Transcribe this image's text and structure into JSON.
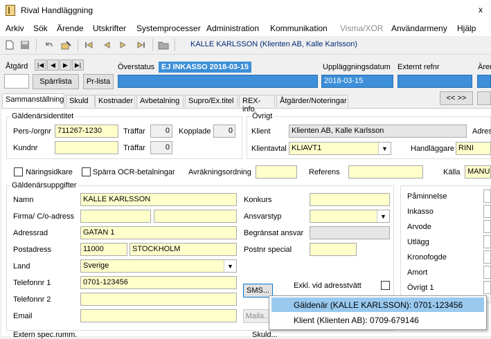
{
  "window": {
    "title": "Rival Handläggning",
    "close_glyph": "x"
  },
  "menu": [
    "Arkiv",
    "Sök",
    "Ärende",
    "Utskrifter",
    "Systemprocesser",
    "Administration",
    "Kommunikation",
    "Visma/XOR",
    "Användarmeny",
    "Hjälp"
  ],
  "toolbar": {
    "client_text": "KALLE KARLSSON (Klienten AB, Kalle Karlsson)"
  },
  "action_bar": {
    "atgard_label": "Åtgärd",
    "sparrlista_button": "Spärrlista",
    "prlista_button": "Pr-lista",
    "overstatus_label": "Överstatus",
    "overstatus_value": "EJ INKASSO 2018-03-15",
    "upplaggningsdatum_label": "Uppläggningsdatum",
    "upplaggningsdatum_value": "2018-03-15",
    "externt_refnr_label": "Externt refnr",
    "arende_label": "Ärer"
  },
  "tabs": [
    "Sammanställning",
    "Skuld",
    "Kostnader",
    "Avbetalning",
    "Supro/Ex.titel",
    "REX-info",
    "Åtgärder/Noteringar"
  ],
  "nav_button": "<< >>",
  "gd_identitet": {
    "title": "Gäldenärsidentitet",
    "pers_label": "Pers-/orgnr",
    "pers_value": "711267-1230",
    "traffar_label": "Träffar",
    "traffar1": "0",
    "kopplade_label": "Kopplade",
    "kopplade_value": "0",
    "kundnr_label": "Kundnr",
    "traffar2": "0"
  },
  "ovrigt": {
    "title": "Övrigt",
    "klient_label": "Klient",
    "klient_value": "Klienten AB, Kalle Karlsson",
    "adress_label": "Adres",
    "klientavtal_label": "Klientavtal",
    "klientavtal_value": "KLIAVT1",
    "handlaggare_label": "Handläggare",
    "handlaggare_value": "RINI"
  },
  "flags": {
    "naringsidkare": "Näringsidkare",
    "sparra_ocr": "Spärra OCR-betalningar",
    "avrakningsordning": "Avräkningsordning",
    "referens": "Referens",
    "kalla_label": "Källa",
    "kalla_value": "MANUE"
  },
  "gd_uppgifter": {
    "title": "Gäldenärsuppgifter",
    "namn_label": "Namn",
    "namn_value": "KALLE KARLSSON",
    "firma_label": "Firma/ C/o-adress",
    "adressrad_label": "Adressrad",
    "adressrad_value": "GATAN 1",
    "postadress_label": "Postadress",
    "postnr_value": "11000",
    "ort_value": "STOCKHOLM",
    "land_label": "Land",
    "land_value": "Sverige",
    "tel1_label": "Telefonnr 1",
    "tel1_value": "0701-123456",
    "tel2_label": "Telefonnr 2",
    "email_label": "Email"
  },
  "right_col": {
    "konkurs_label": "Konkurs",
    "ansvarstyp_label": "Ansvarstyp",
    "begransat_label": "Begränsat ansvar",
    "postnr_special_label": "Postnr special",
    "sms_button": "SMS...",
    "mail_button": "Maila...",
    "exkl_label": "Exkl. vid adresstvätt"
  },
  "kostnader": [
    "Påminnelse",
    "Inkasso",
    "Arvode",
    "Utlägg",
    "Kronofogde",
    "Amort",
    "Övrigt 1"
  ],
  "popup": {
    "item1": "Gäldenär (KALLE KARLSSON): 0701-123456",
    "item2": "Klient (Klienten AB): 0709-679146"
  },
  "bottom": {
    "left": "Extern spec.rumm.",
    "right": "Skuld..."
  }
}
